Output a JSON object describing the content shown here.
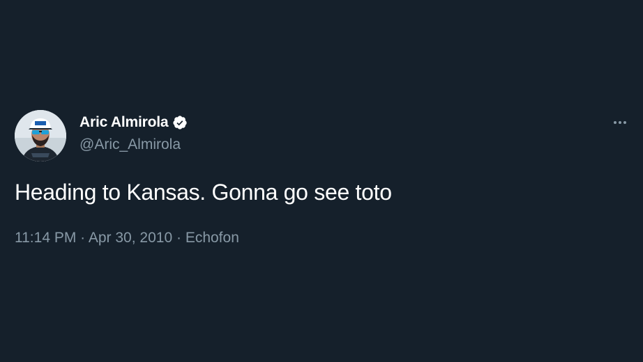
{
  "author": {
    "display_name": "Aric Almirola",
    "handle": "@Aric_Almirola",
    "verified": true,
    "avatar_icon": "profile-photo"
  },
  "tweet": {
    "text": "Heading to Kansas. Gonna go see toto",
    "time": "11:14 PM",
    "separator": "·",
    "date": "Apr 30, 2010",
    "source": "Echofon"
  },
  "menu": {
    "icon": "more-options-icon"
  },
  "colors": {
    "background": "#15202b",
    "primary_text": "#ffffff",
    "secondary_text": "#8899a6",
    "verified_badge": "#ffffff"
  }
}
